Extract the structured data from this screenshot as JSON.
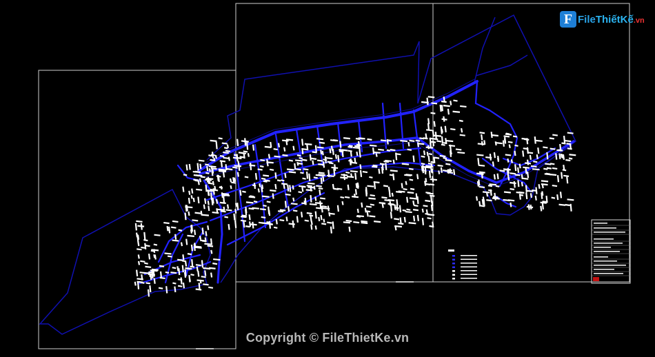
{
  "app": {
    "type": "cad-drawing-preview",
    "background": "#000000"
  },
  "colors": {
    "road": "#1a1aff",
    "road_thick": "#2b2bff",
    "boundary": "#0d0daa",
    "frame": "#d0d0d0",
    "label": "#ffffff",
    "watermark": "#b8b8b8",
    "logo_blue": "#29a3e8",
    "logo_red": "#e33333"
  },
  "logo": {
    "icon": "file-logo-icon",
    "prefix": "File",
    "name": "ThiếtKế",
    "suffix": ".vn"
  },
  "watermark": {
    "text": "Copyright © FileThietKe.vn"
  },
  "sheets": [
    {
      "name": "sheet-left"
    },
    {
      "name": "sheet-center"
    },
    {
      "name": "sheet-right"
    }
  ],
  "title_block": {
    "name": "title-block"
  },
  "legend": {
    "name": "legend-block"
  }
}
